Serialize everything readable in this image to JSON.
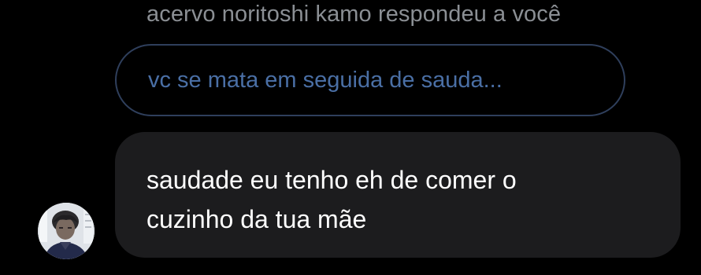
{
  "reply_header": "acervo noritoshi kamo respondeu a você",
  "quoted_message": "vc se mata em seguida de sauda...",
  "message": {
    "text": "saudade eu tenho eh de comer o\ncuzinho da tua mãe"
  },
  "avatar": {
    "icon": "person-portrait"
  },
  "colors": {
    "background": "#000000",
    "header_text": "#8b8f94",
    "quoted_border": "#2f3f5c",
    "quoted_text": "#4a6fa5",
    "bubble_bg": "#1c1c1e",
    "message_text": "#ffffff"
  }
}
